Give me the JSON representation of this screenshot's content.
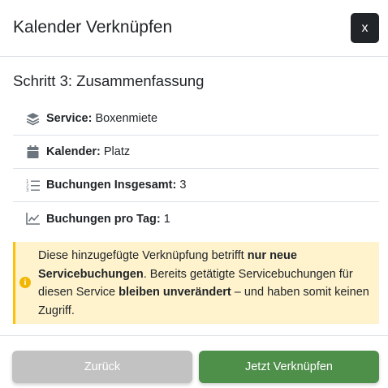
{
  "modal": {
    "title": "Kalender Verknüpfen",
    "close_label": "x"
  },
  "step": {
    "title": "Schritt 3: Zusammenfassung"
  },
  "summary": [
    {
      "icon": "layers-icon",
      "label": "Service:",
      "value": "Boxenmiete"
    },
    {
      "icon": "calendar-icon",
      "label": "Kalender:",
      "value": "Platz"
    },
    {
      "icon": "list-ordered-icon",
      "label": "Buchungen Insgesamt:",
      "value": "3"
    },
    {
      "icon": "line-chart-icon",
      "label": "Buchungen pro Tag:",
      "value": "1"
    }
  ],
  "alert": {
    "icon": "info-icon",
    "t1": "Diese hinzugefügte Verknüpfung betrifft ",
    "b1": "nur neue Servicebuchungen",
    "t2": ". Bereits getätigte Servicebuchungen für diesen Service ",
    "b2": "bleiben unverändert",
    "t3": " – und haben somit keinen Zugriff."
  },
  "footer": {
    "back_label": "Zurück",
    "link_label": "Jetzt Verknüpfen"
  },
  "colors": {
    "primary_button": "#4e8f4a",
    "secondary_button": "#c2c2c2",
    "alert_background": "#fff3cd",
    "alert_border": "#ffc107"
  }
}
